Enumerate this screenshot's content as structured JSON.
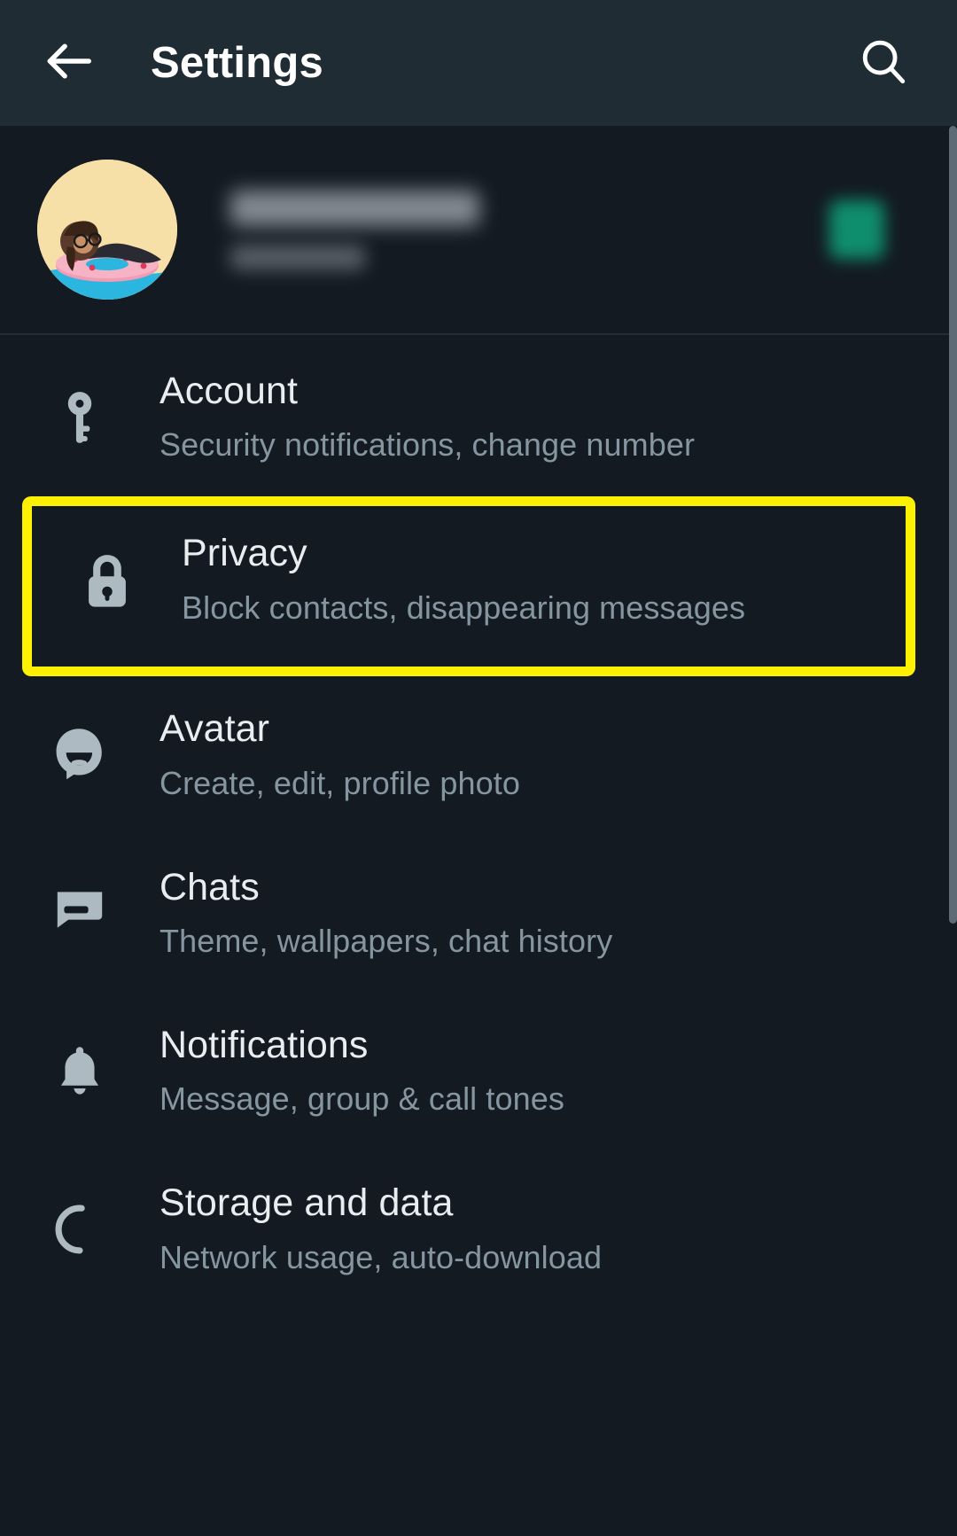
{
  "appbar": {
    "back_icon": "arrow-left-icon",
    "title": "Settings",
    "search_icon": "search-icon"
  },
  "profile": {
    "name": "",
    "status": "",
    "name_redacted": true,
    "status_redacted": true,
    "avatar_icon": "profile-avatar-photo",
    "qr_icon": "qr-code-icon"
  },
  "settings_items": [
    {
      "id": "account",
      "icon": "key-icon",
      "title": "Account",
      "subtitle": "Security notifications, change number",
      "highlighted": false
    },
    {
      "id": "privacy",
      "icon": "lock-icon",
      "title": "Privacy",
      "subtitle": "Block contacts, disappearing messages",
      "highlighted": true
    },
    {
      "id": "avatar",
      "icon": "avatar-sticker-icon",
      "title": "Avatar",
      "subtitle": "Create, edit, profile photo",
      "highlighted": false
    },
    {
      "id": "chats",
      "icon": "chat-bubble-icon",
      "title": "Chats",
      "subtitle": "Theme, wallpapers, chat history",
      "highlighted": false
    },
    {
      "id": "notifications",
      "icon": "bell-icon",
      "title": "Notifications",
      "subtitle": "Message, group & call tones",
      "highlighted": false
    },
    {
      "id": "storage",
      "icon": "storage-refresh-icon",
      "title": "Storage and data",
      "subtitle": "Network usage, auto-download",
      "highlighted": false
    }
  ],
  "colors": {
    "background": "#131a22",
    "appbar": "#1f2c34",
    "title_text": "#e9edef",
    "subtitle_text": "#8696a0",
    "highlight_border": "#fdf000",
    "icon": "#aebac1",
    "accent_green": "#0f9b77"
  }
}
